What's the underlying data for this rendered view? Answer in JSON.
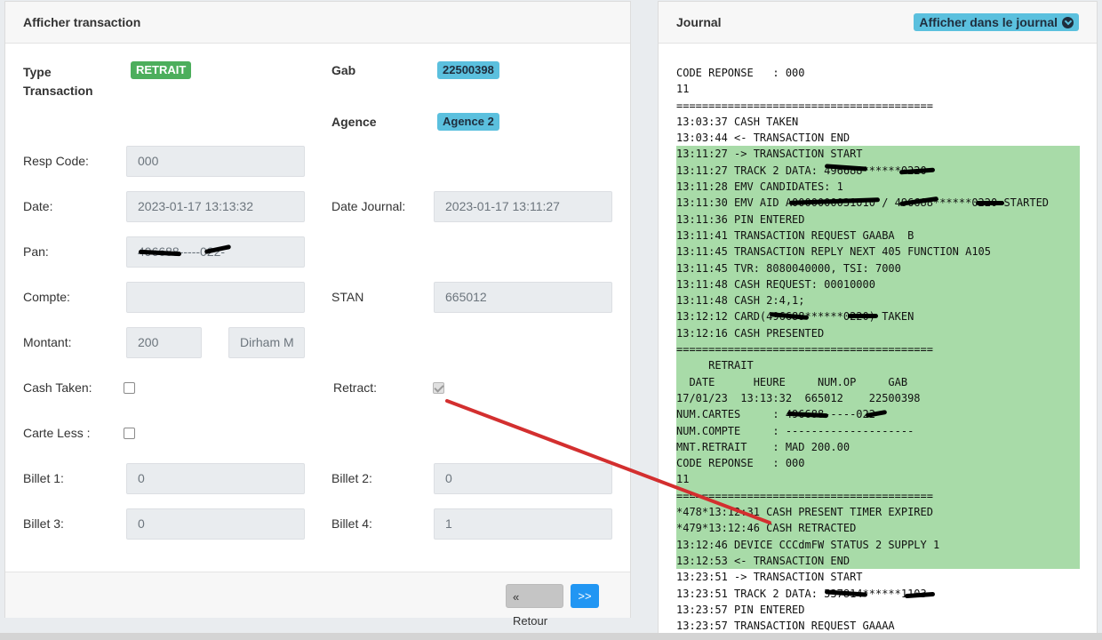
{
  "left_panel": {
    "title": "Afficher transaction",
    "type_transaction_label": "Type\nTransaction",
    "type_transaction_value": "RETRAIT",
    "gab_label": "Gab",
    "gab_value": "22500398",
    "agence_label": "Agence",
    "agence_value": "Agence 2",
    "resp_code_label": "Resp Code:",
    "resp_code_value": "000",
    "date_label": "Date:",
    "date_value": "2023-01-17 13:13:32",
    "date_journal_label": "Date Journal:",
    "date_journal_value": "2023-01-17 13:11:27",
    "pan_label": "Pan:",
    "pan_value": "496688-----022-",
    "compte_label": "Compte:",
    "compte_value": "",
    "stan_label": "STAN",
    "stan_value": "665012",
    "montant_label": "Montant:",
    "montant_value": "200",
    "currency_value": "Dirham M",
    "cash_taken_label": "Cash Taken:",
    "cash_taken_checked": false,
    "retract_label": "Retract:",
    "retract_checked": true,
    "carte_less_label": "Carte Less :",
    "carte_less_checked": false,
    "billet1_label": "Billet 1:",
    "billet1_value": "0",
    "billet2_label": "Billet 2:",
    "billet2_value": "0",
    "billet3_label": "Billet 3:",
    "billet3_value": "0",
    "billet4_label": "Billet 4:",
    "billet4_value": "1",
    "back_button": "« Retour",
    "next_button": ">>"
  },
  "right_panel": {
    "title": "Journal",
    "dropdown_label": "Afficher dans le journal",
    "lines": [
      {
        "text": "CODE REPONSE   : 000",
        "hl": false
      },
      {
        "text": "11",
        "hl": false
      },
      {
        "text": "========================================",
        "hl": false
      },
      {
        "text": "13:03:37 CASH TAKEN",
        "hl": false
      },
      {
        "text": "13:03:44 <- TRANSACTION END",
        "hl": false
      },
      {
        "text": "13:11:27 -> TRANSACTION START",
        "hl": true
      },
      {
        "text": "13:11:27 TRACK 2 DATA: 496688******0220",
        "hl": true
      },
      {
        "text": "13:11:28 EMV CANDIDATES: 1",
        "hl": true
      },
      {
        "text": "13:11:30 EMV AID A0000000031010 / 496688******0220 STARTED",
        "hl": true
      },
      {
        "text": "13:11:36 PIN ENTERED",
        "hl": true
      },
      {
        "text": "13:11:41 TRANSACTION REQUEST GAABA  B",
        "hl": true
      },
      {
        "text": "13:11:45 TRANSACTION REPLY NEXT 405 FUNCTION A105",
        "hl": true
      },
      {
        "text": "13:11:45 TVR: 8080040000, TSI: 7000",
        "hl": true
      },
      {
        "text": "13:11:48 CASH REQUEST: 00010000",
        "hl": true
      },
      {
        "text": "13:11:48 CASH 2:4,1;",
        "hl": true
      },
      {
        "text": "13:12:12 CARD(496688******0220) TAKEN",
        "hl": true
      },
      {
        "text": "13:12:16 CASH PRESENTED",
        "hl": true
      },
      {
        "text": "========================================",
        "hl": true
      },
      {
        "text": "     RETRAIT",
        "hl": true
      },
      {
        "text": "  DATE      HEURE     NUM.OP     GAB",
        "hl": true
      },
      {
        "text": "17/01/23  13:13:32  665012    22500398",
        "hl": true
      },
      {
        "text": "NUM.CARTES     : 496688-----022-",
        "hl": true
      },
      {
        "text": "NUM.COMPTE     : --------------------",
        "hl": true
      },
      {
        "text": "MNT.RETRAIT    : MAD 200.00",
        "hl": true
      },
      {
        "text": "CODE REPONSE   : 000",
        "hl": true
      },
      {
        "text": "11",
        "hl": true
      },
      {
        "text": "========================================",
        "hl": true
      },
      {
        "text": "*478*13:12:31 CASH PRESENT TIMER EXPIRED",
        "hl": true
      },
      {
        "text": "*479*13:12:46 CASH RETRACTED",
        "hl": true
      },
      {
        "text": "13:12:46 DEVICE CCCdmFW STATUS 2 SUPPLY 1",
        "hl": true
      },
      {
        "text": "13:12:53 <- TRANSACTION END",
        "hl": true
      },
      {
        "text": "13:23:51 -> TRANSACTION START",
        "hl": false
      },
      {
        "text": "13:23:51 TRACK 2 DATA: 537814******1103",
        "hl": false
      },
      {
        "text": "13:23:57 PIN ENTERED",
        "hl": false
      },
      {
        "text": "13:23:57 TRANSACTION REQUEST GAAAA",
        "hl": false
      }
    ]
  },
  "colors": {
    "highlight": "#a8dba8",
    "arrow": "#d32f2f",
    "badge_green": "#4cae5c",
    "badge_blue": "#5bc0de",
    "next_button": "#2196f3"
  }
}
